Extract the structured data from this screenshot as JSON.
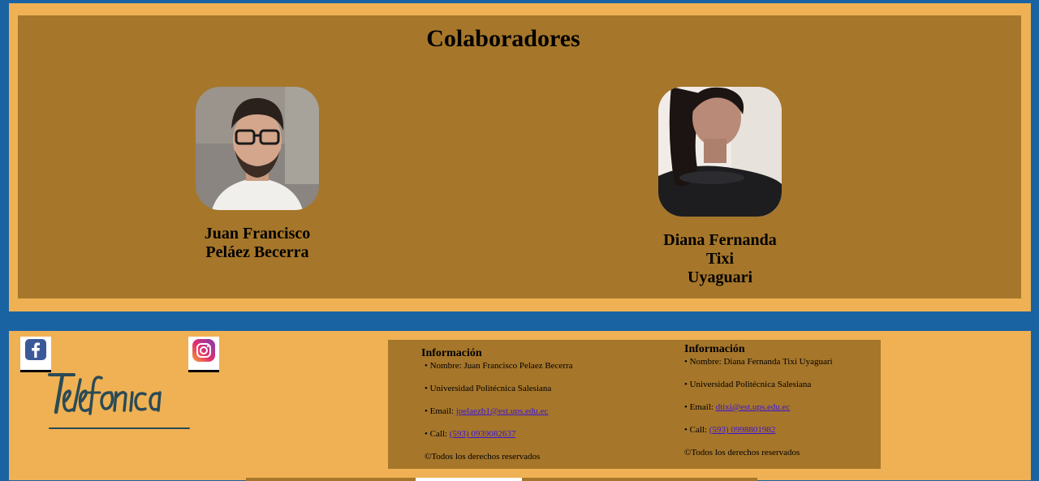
{
  "collaborators": {
    "title": "Colaboradores",
    "people": [
      {
        "name_line1": "Juan Francisco",
        "name_line2": "Peláez Becerra"
      },
      {
        "name_line1": "Diana Fernanda Tixi",
        "name_line2": "Uyaguari"
      }
    ]
  },
  "footer": {
    "social": [
      {
        "icon": "facebook-icon",
        "color": "#3b5998"
      },
      {
        "icon": "instagram-icon",
        "color": "#c13584"
      }
    ],
    "logo_text": "Telefonica",
    "info": [
      {
        "title": "Información",
        "name": "• Nombre: Juan Francisco Pelaez Becerra",
        "university": "• Universidad Politécnica Salesiana",
        "email_label": "• Email: ",
        "email": "jpelaezb1@est.ups.edu.ec",
        "call_label": "• Call: ",
        "phone": "(593) 0939082637",
        "copyright": "©Todos los derechos reservados"
      },
      {
        "title": "Información",
        "name": "• Nombre: Diana Fernanda Tixi Uyaguari",
        "university": "• Universidad Politécnica Salesiana",
        "email_label": "• Email: ",
        "email": "dtixi@est.ups.edu.ec",
        "call_label": "• Call: ",
        "phone": "(593) 0998801982",
        "copyright": "©Todos los derechos reservados"
      }
    ]
  },
  "colors": {
    "page_bg": "#1a63a3",
    "panel_light": "#efb153",
    "panel_dark": "#a6762a",
    "link": "#3a16d6"
  }
}
